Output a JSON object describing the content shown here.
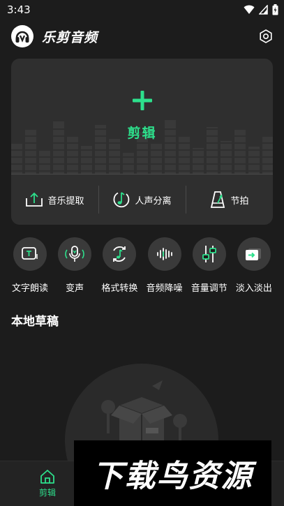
{
  "status_bar": {
    "time": "3:43",
    "icons": [
      "wifi-icon",
      "signal-icon",
      "battery-icon"
    ]
  },
  "header": {
    "app_title": "乐剪音频",
    "logo_icon": "headphone-logo-icon",
    "settings_icon": "gear-icon"
  },
  "edit_card": {
    "main_label": "剪辑",
    "actions": [
      {
        "label": "音乐提取",
        "icon": "upload-tray-icon"
      },
      {
        "label": "人声分离",
        "icon": "music-note-circle-icon"
      },
      {
        "label": "节拍",
        "icon": "metronome-icon"
      }
    ]
  },
  "tools": [
    {
      "label": "文字朗读",
      "icon": "text-to-speech-icon"
    },
    {
      "label": "变声",
      "icon": "microphone-icon"
    },
    {
      "label": "格式转换",
      "icon": "convert-note-icon"
    },
    {
      "label": "音频降噪",
      "icon": "waveform-icon"
    },
    {
      "label": "音量调节",
      "icon": "sliders-icon"
    },
    {
      "label": "淡入淡出",
      "icon": "fade-arrow-icon"
    }
  ],
  "drafts": {
    "section_title": "本地草稿"
  },
  "bottom_nav": {
    "items": [
      {
        "label": "剪辑",
        "icon": "home-icon",
        "active": true
      }
    ]
  },
  "watermark": {
    "text": "下载鸟资源"
  },
  "colors": {
    "accent": "#2de08c",
    "background": "#1c1c1c",
    "card": "#2f2f2f",
    "tool_circle": "#3a3a3a"
  }
}
